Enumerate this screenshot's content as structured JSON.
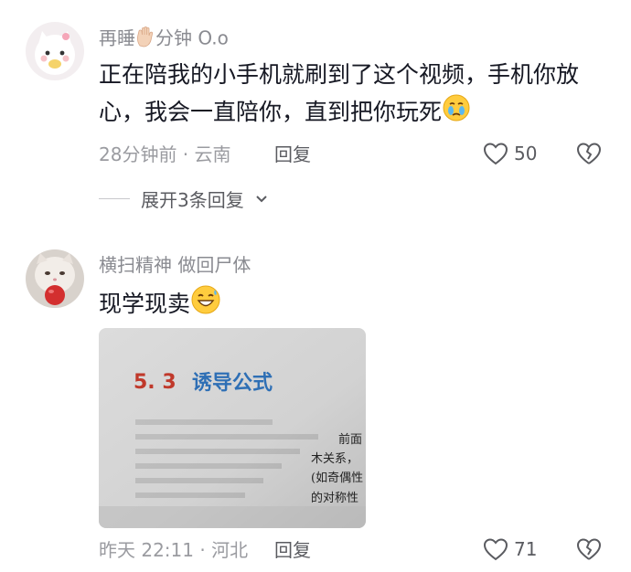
{
  "comments": [
    {
      "username_prefix": "再睡",
      "username_suffix": "分钟 O.o",
      "text": "正在陪我的小手机就刷到了这个视频，手机你放心，我会一直陪你，直到把你玩死",
      "time_location": "28分钟前 · 云南",
      "reply_label": "回复",
      "like_count": "50",
      "expand_label": "展开3条回复"
    },
    {
      "username": "横扫精神 做回尸体",
      "text": "现学现卖",
      "image_text": {
        "section_number": "5. 3",
        "section_title": "诱导公式",
        "line1": "前面",
        "line2": "木关系，",
        "line3": "(如奇偶性",
        "line4": "的对称性"
      },
      "time_location": "昨天 22:11 · 河北",
      "reply_label": "回复",
      "like_count": "71"
    }
  ],
  "colors": {
    "primary_text": "#161823",
    "secondary_text": "#8a8b91",
    "section_number": "#c0392b",
    "section_title": "#2e6fb5"
  }
}
